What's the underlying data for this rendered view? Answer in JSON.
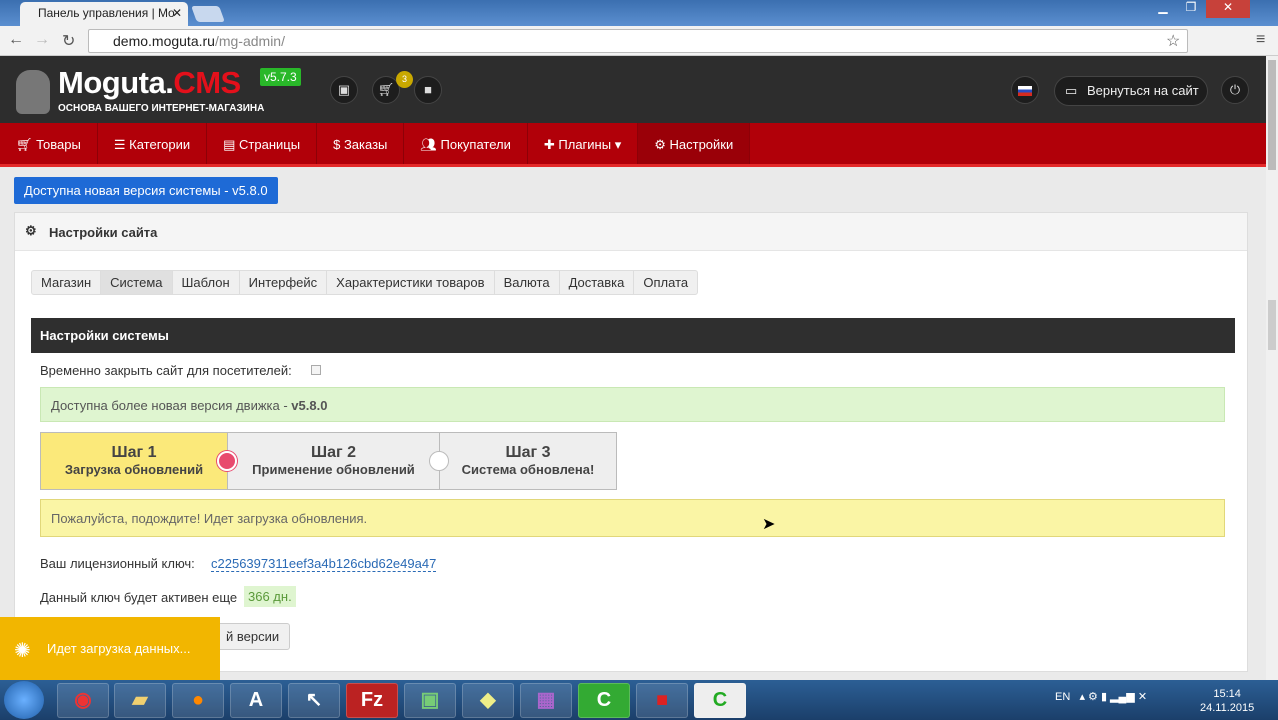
{
  "browser": {
    "tab_title": "Панель управления | Mo",
    "url_host": "demo.moguta.ru",
    "url_path": "/mg-admin/"
  },
  "header": {
    "logo_main": "Moguta.",
    "logo_accent": "CMS",
    "version": "v5.7.3",
    "tagline": "ОСНОВА ВАШЕГО ИНТЕРНЕТ-МАГАЗИНА",
    "cart_count": "3",
    "back_to_site": "Вернуться на сайт"
  },
  "menu": [
    {
      "icon": "cart",
      "label": "Товары"
    },
    {
      "icon": "list",
      "label": "Категории"
    },
    {
      "icon": "page",
      "label": "Страницы"
    },
    {
      "icon": "bag",
      "label": "Заказы"
    },
    {
      "icon": "users",
      "label": "Покупатели"
    },
    {
      "icon": "puzzle",
      "label": "Плагины ▾"
    },
    {
      "icon": "gears",
      "label": "Настройки"
    }
  ],
  "new_version_banner": "Доступна новая версия системы - v5.8.0",
  "panel": {
    "title": "Настройки сайта",
    "tabs": [
      "Магазин",
      "Система",
      "Шаблон",
      "Интерфейс",
      "Характеристики товаров",
      "Валюта",
      "Доставка",
      "Оплата"
    ],
    "section_title": "Настройки системы",
    "close_site_label": "Временно закрыть сайт для посетителей:",
    "available_text": "Доступна более новая версия движка - ",
    "available_version": "v5.8.0",
    "steps": [
      {
        "title": "Шаг 1",
        "sub": "Загрузка обновлений"
      },
      {
        "title": "Шаг 2",
        "sub": "Применение обновлений"
      },
      {
        "title": "Шаг 3",
        "sub": "Система обновлена!"
      }
    ],
    "wait_text": "Пожалуйста, подождите! Идет загрузка обновления.",
    "license_label": "Ваш лицензионный ключ:",
    "license_key": "c2256397311eef3a4b126cbd62e49a47",
    "active_label": "Данный ключ будет активен еще",
    "active_days": "366 дн.",
    "check_button": "й версии"
  },
  "loading": "Идет загрузка данных...",
  "taskbar": {
    "lang": "EN",
    "time": "15:14",
    "date": "24.11.2015"
  }
}
